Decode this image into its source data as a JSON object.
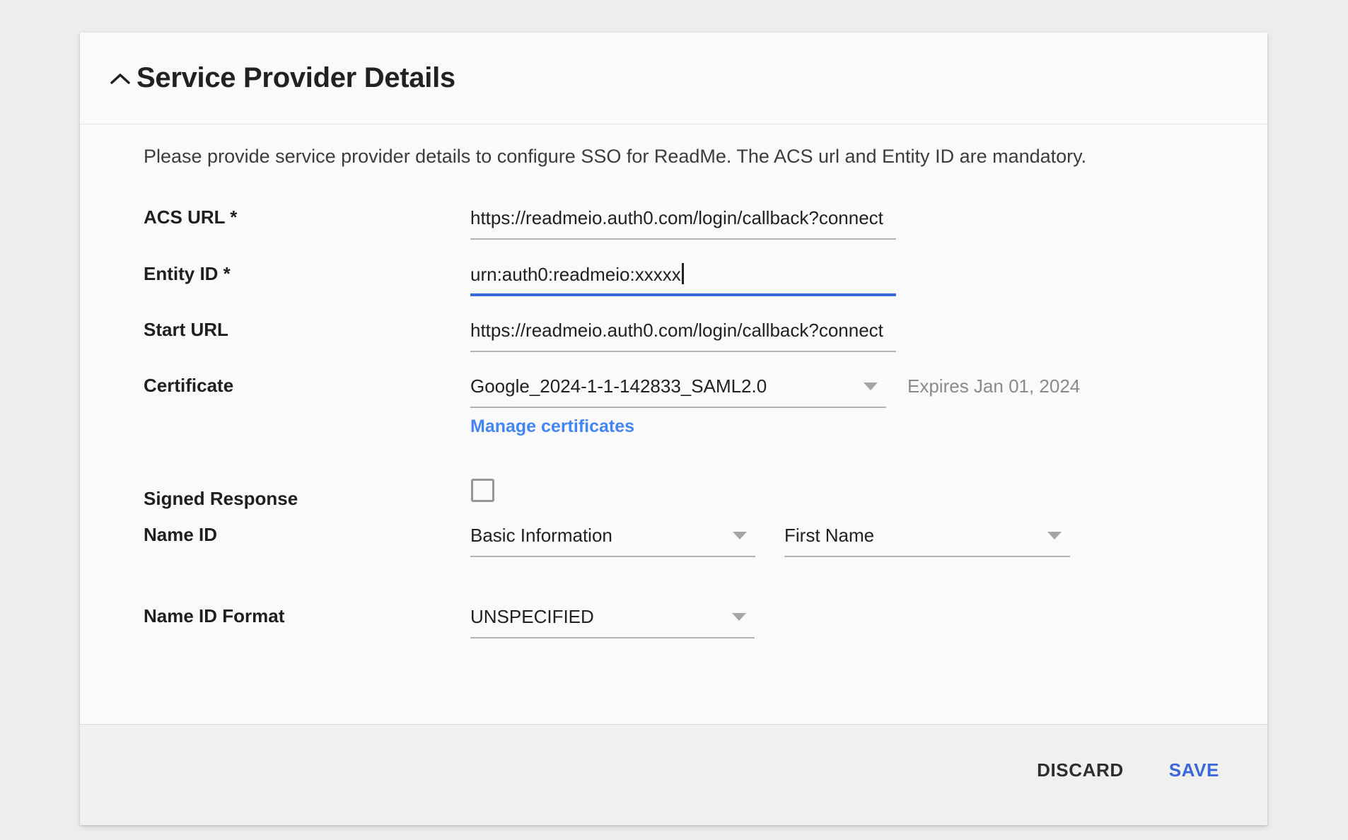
{
  "panel": {
    "title": "Service Provider Details",
    "description": "Please provide service provider details to configure SSO for ReadMe. The ACS url and Entity ID are mandatory."
  },
  "fields": {
    "acs_url": {
      "label": "ACS URL *",
      "value": "https://readmeio.auth0.com/login/callback?connect"
    },
    "entity_id": {
      "label": "Entity ID *",
      "value": "urn:auth0:readmeio:xxxxx"
    },
    "start_url": {
      "label": "Start URL",
      "value": "https://readmeio.auth0.com/login/callback?connect"
    },
    "certificate": {
      "label": "Certificate",
      "value": "Google_2024-1-1-142833_SAML2.0",
      "expiry": "Expires Jan 01, 2024",
      "manage_link": "Manage certificates"
    },
    "signed_response": {
      "label": "Signed Response",
      "checked": false
    },
    "name_id": {
      "label": "Name ID",
      "category_value": "Basic Information",
      "attribute_value": "First Name"
    },
    "name_id_format": {
      "label": "Name ID Format",
      "value": "UNSPECIFIED"
    }
  },
  "footer": {
    "discard_label": "DISCARD",
    "save_label": "SAVE"
  },
  "colors": {
    "accent_blue": "#3b68d8",
    "link_blue": "#4285f4",
    "underline_gray": "#b2b2b2"
  },
  "icons": {
    "collapse": "chevron-up",
    "dropdown": "triangle-down"
  }
}
